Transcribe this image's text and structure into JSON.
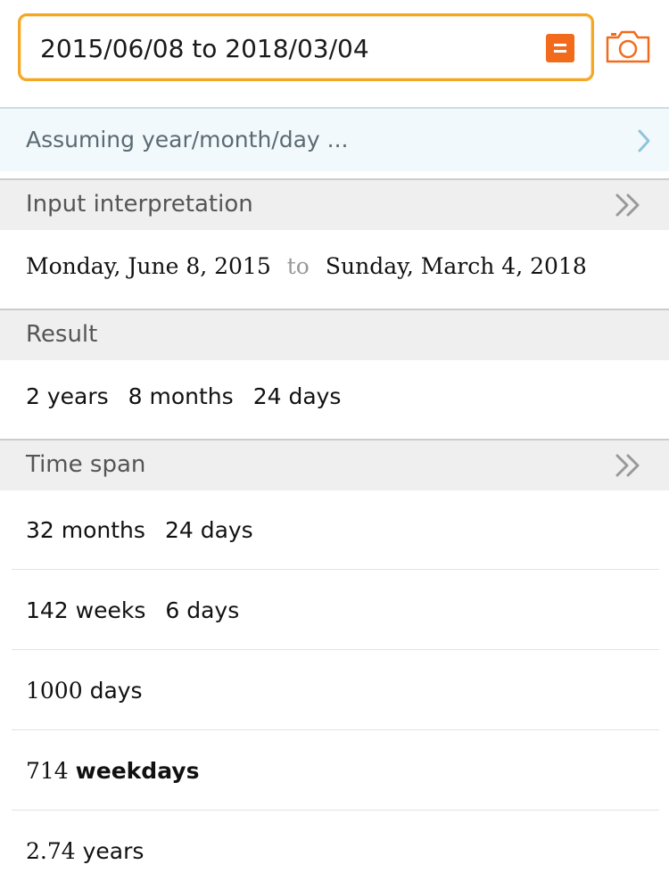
{
  "search": {
    "value": "2015/06/08 to 2018/03/04",
    "submit_icon": "equals-icon",
    "camera_icon": "camera-icon"
  },
  "assumption": {
    "text": "Assuming year/month/day ...",
    "chevron_icon": "chevron-right-icon"
  },
  "pods": {
    "input_interpretation": {
      "title": "Input interpretation",
      "start": "Monday, June 8, 2015",
      "to": "to",
      "end": "Sunday, March 4, 2018"
    },
    "result": {
      "title": "Result",
      "parts": [
        "2 years",
        "8 months",
        "24 days"
      ]
    },
    "time_span": {
      "title": "Time span",
      "row1": [
        "32 months",
        "24 days"
      ],
      "row2": [
        "142 weeks",
        "6 days"
      ],
      "row3_number": "1000",
      "row3_unit": "days",
      "row4_number": "714",
      "row4_unit": "weekdays",
      "row5_number": "2.74",
      "row5_unit": "years"
    }
  },
  "colors": {
    "accent_orange": "#f5a623",
    "submit_orange": "#f26b1d",
    "assume_bg": "#f2f9fc",
    "header_bg": "#efefef"
  }
}
